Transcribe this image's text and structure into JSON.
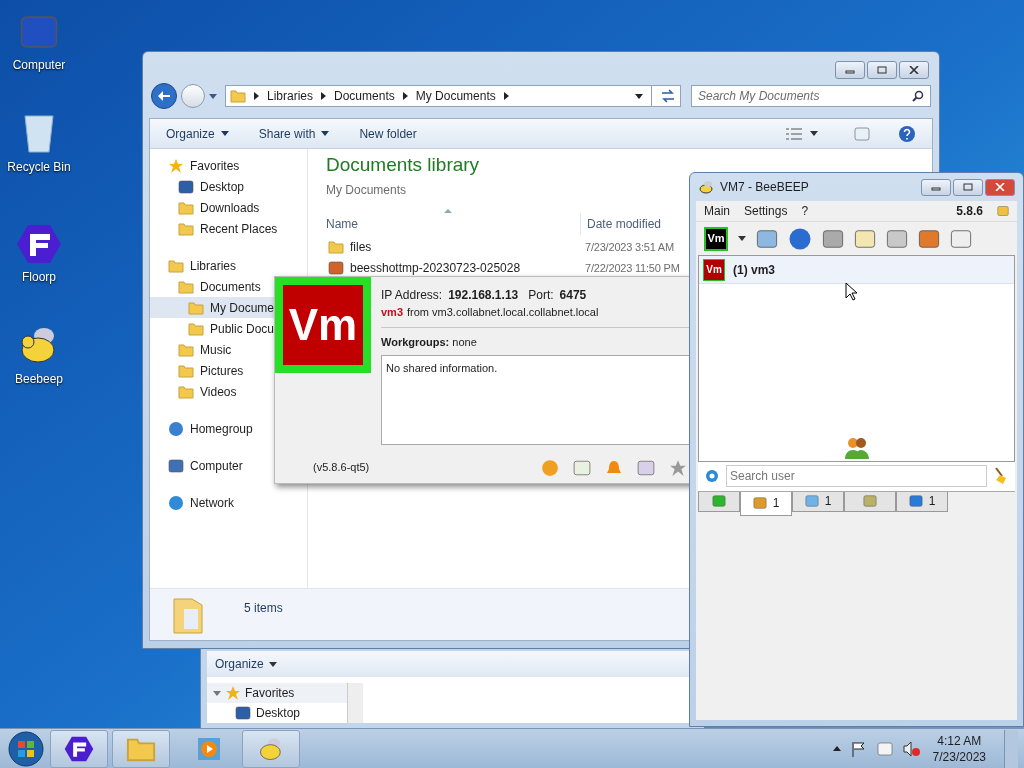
{
  "desktop_icons": [
    {
      "label": "Computer"
    },
    {
      "label": "Recycle Bin"
    },
    {
      "label": "Floorp"
    },
    {
      "label": "Beebeep"
    }
  ],
  "explorer": {
    "breadcrumb": [
      "Libraries",
      "Documents",
      "My Documents"
    ],
    "search_placeholder": "Search My Documents",
    "toolbar": [
      "Organize",
      "Share with",
      "New folder"
    ],
    "sidebar": [
      {
        "label": "Favorites",
        "selected": false,
        "children": [
          {
            "label": "Desktop",
            "selected": false
          },
          {
            "label": "Downloads",
            "selected": false
          },
          {
            "label": "Recent Places",
            "selected": false
          }
        ]
      },
      {
        "label": "Libraries",
        "selected": false,
        "children": [
          {
            "label": "Documents",
            "selected": false,
            "children": [
              {
                "label": "My Docume",
                "selected": true
              },
              {
                "label": "Public Docu",
                "selected": false
              }
            ]
          },
          {
            "label": "Music",
            "selected": false
          },
          {
            "label": "Pictures",
            "selected": false
          },
          {
            "label": "Videos",
            "selected": false
          }
        ]
      },
      {
        "label": "Homegroup",
        "selected": false
      },
      {
        "label": "Computer",
        "selected": false
      },
      {
        "label": "Network",
        "selected": false
      }
    ],
    "library_title": "Documents library",
    "library_subtitle": "My Documents",
    "columns": [
      "Name",
      "Date modified"
    ],
    "files": [
      {
        "kind": "folder",
        "name": "files",
        "date": "7/23/2023 3:51 AM"
      },
      {
        "kind": "image",
        "name": "beesshottmp-20230723-025028",
        "date": "7/22/2023 11:50 PM"
      }
    ],
    "status": "5 items"
  },
  "explorer_behind": {
    "toolbar": [
      "Organize"
    ],
    "sidebar": [
      {
        "label": "Favorites",
        "children": [
          {
            "label": "Desktop"
          }
        ]
      }
    ]
  },
  "popup": {
    "avatar_text": "Vm",
    "ip_label": "IP Address:",
    "ip": "192.168.1.13",
    "port_label": "Port:",
    "port": "6475",
    "user": "vm3",
    "host": "from vm3.collabnet.local.collabnet.local",
    "workgroups": "**Workgroups:** none",
    "shared_info": "No shared information.",
    "version": "(v5.8.6-qt5)"
  },
  "beebeep": {
    "title": "VM7 - BeeBEEP",
    "menu": [
      "Main",
      "Settings",
      "?"
    ],
    "version": "5.8.6",
    "toolbar_avatar": "Vm",
    "users": [
      {
        "avatar": "Vm",
        "label": "(1) vm3",
        "selected": true
      }
    ],
    "search_placeholder": "Search user",
    "tabs": [
      {
        "selected": false
      },
      {
        "count": "1",
        "selected": true
      },
      {
        "count": "1",
        "selected": false
      },
      {
        "selected": false
      },
      {
        "count": "1",
        "selected": false
      }
    ]
  },
  "taskbar": {
    "time": "4:12 AM",
    "date": "7/23/2023"
  }
}
